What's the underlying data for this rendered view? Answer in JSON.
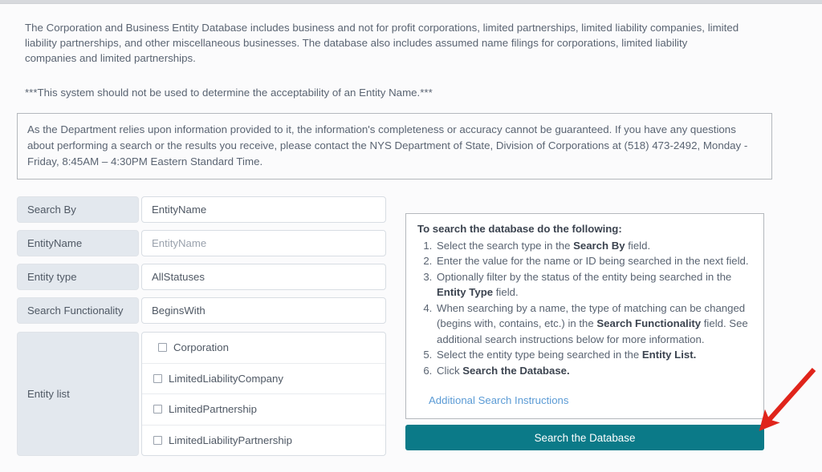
{
  "intro": {
    "paragraph": "The Corporation and Business Entity Database includes business and not for profit corporations, limited partnerships, limited liability companies, limited liability partnerships, and other miscellaneous businesses. The database also includes assumed name filings for corporations, limited liability companies and limited partnerships.",
    "note": "***This system should not be used to determine the acceptability of an Entity Name.***"
  },
  "disclaimer": {
    "text": "As the Department relies upon information provided to it, the information's completeness or accuracy cannot be guaranteed. If you have any questions about performing a search or the results you receive, please contact the NYS Department of State, Division of Corporations at (518) 473-2492, Monday - Friday, 8:45AM – 4:30PM Eastern Standard Time."
  },
  "form": {
    "rows": [
      {
        "label": "Search By",
        "value": "EntityName",
        "is_placeholder": false
      },
      {
        "label": "EntityName",
        "value": "EntityName",
        "is_placeholder": true
      },
      {
        "label": "Entity type",
        "value": "AllStatuses",
        "is_placeholder": false
      },
      {
        "label": "Search Functionality",
        "value": "BeginsWith",
        "is_placeholder": false
      }
    ],
    "entity_list": {
      "label": "Entity list",
      "options": [
        {
          "label": "Corporation",
          "checked": false
        },
        {
          "label": "LimitedLiabilityCompany",
          "checked": false
        },
        {
          "label": "LimitedPartnership",
          "checked": false
        },
        {
          "label": "LimitedLiabilityPartnership",
          "checked": false
        }
      ]
    }
  },
  "instructions": {
    "heading": "To search the database do the following:",
    "steps": [
      {
        "pre": "Select the search type in the ",
        "bold": "Search By",
        "post": " field."
      },
      {
        "pre": "Enter the value for the name or ID being searched in the next field.",
        "bold": "",
        "post": ""
      },
      {
        "pre": "Optionally filter by the status of the entity being searched in the ",
        "bold": "Entity Type",
        "post": " field."
      },
      {
        "pre": "When searching by a name, the type of matching can be changed (begins with, contains, etc.) in the ",
        "bold": "Search Functionality",
        "post": " field. See additional search instructions below for more information."
      },
      {
        "pre": "Select the entity type being searched in the ",
        "bold": "Entity List.",
        "post": ""
      },
      {
        "pre": "Click ",
        "bold": "Search the Database.",
        "post": ""
      }
    ],
    "link": "Additional Search Instructions"
  },
  "actions": {
    "search_button": "Search the Database"
  },
  "annotation": {
    "arrow_color": "#e0241b",
    "arrow_name": "red-pointer-arrow"
  },
  "colors": {
    "button_teal": "#0b7a88",
    "link_blue": "#5b9bd5",
    "label_bg": "#e3e8ee",
    "text": "#5a6472"
  }
}
